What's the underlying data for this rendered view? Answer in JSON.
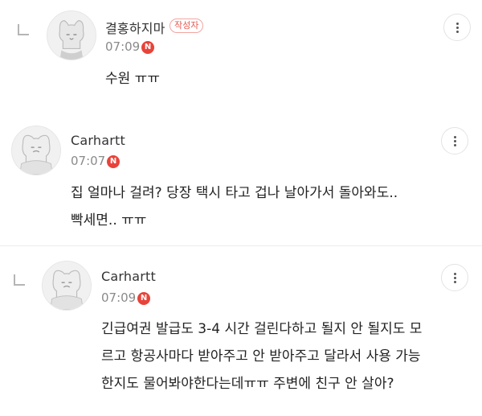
{
  "comments": [
    {
      "author": "결홍하지마",
      "badge": "작성자",
      "time": "07:09",
      "new_icon_label": "N",
      "lines": [
        "수원 ㅠㅠ"
      ]
    },
    {
      "author": "Carhartt",
      "time": "07:07",
      "new_icon_label": "N",
      "lines": [
        "집 얼마나 걸려? 당장 택시 타고 겁나 날아가서 돌아와도..",
        "빡세면.. ㅠㅠ"
      ]
    },
    {
      "author": "Carhartt",
      "time": "07:09",
      "new_icon_label": "N",
      "lines": [
        "긴급여권 발급도 3-4 시간 걸린다하고 될지 안 될지도 모",
        "르고 항공사마다 받아주고 안 받아주고 달라서 사용 가능",
        "한지도 물어봐야한다는데ㅠㅠ 주변에 친구 안 살아?"
      ]
    }
  ]
}
